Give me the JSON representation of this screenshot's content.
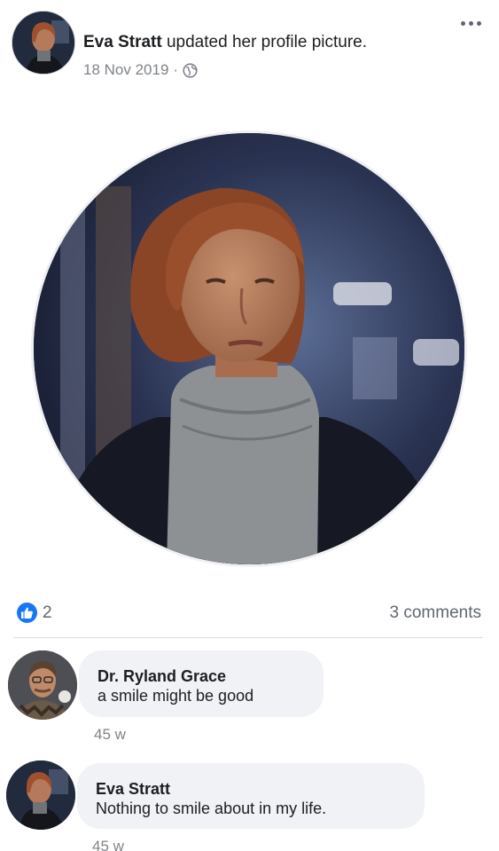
{
  "post": {
    "author": "Eva Stratt",
    "action": "updated her profile picture.",
    "date": "18 Nov 2019",
    "separator": "·",
    "privacy_icon": "globe-icon",
    "more_icon": "more-options-icon"
  },
  "reactions": {
    "like_count": "2",
    "comments_label": "3 comments"
  },
  "comments": [
    {
      "name": "Dr. Ryland Grace",
      "text": "a smile might be good",
      "time": "45 w"
    },
    {
      "name": "Eva Stratt",
      "text": "Nothing to smile about in my life.",
      "time": "45 w"
    }
  ],
  "colors": {
    "like_blue": "#1877f2",
    "bubble_bg": "#f0f2f5",
    "meta_gray": "#7f8389"
  }
}
